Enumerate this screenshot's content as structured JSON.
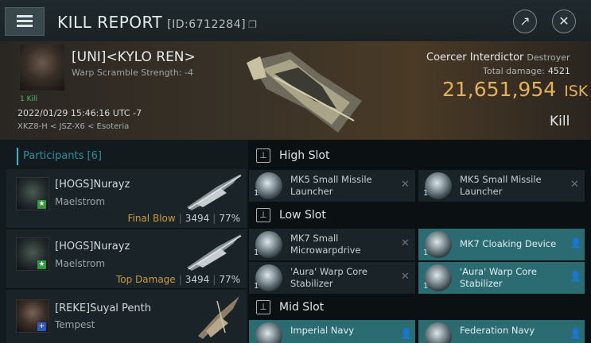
{
  "window": {
    "title": "KILL REPORT",
    "id_label": "[ID:6712284]"
  },
  "victim": {
    "name": "[UNI]<KYLO REN>",
    "warp_scramble": "Warp Scramble Strength: -4",
    "kill_count": "1 Kill",
    "datetime": "2022/01/29 15:46:16 UTC -7",
    "location": "XKZ8-H < JSZ-X6 < Esoteria",
    "ship_name": "Coercer Interdictor",
    "ship_class": "Destroyer",
    "total_damage_label": "Total damage:",
    "total_damage": "4521",
    "isk_value": "21,651,954",
    "isk_unit": "ISK",
    "result": "Kill"
  },
  "participants": {
    "header": "Participants [6]",
    "rows": [
      {
        "name": "[HOGS]Nurayz",
        "ship": "Maelstrom",
        "label": "Final Blow",
        "damage": "3494",
        "percent": "77%",
        "badge": "★",
        "badge_color": "#2f9a3c"
      },
      {
        "name": "[HOGS]Nurayz",
        "ship": "Maelstrom",
        "label": "Top Damage",
        "damage": "3494",
        "percent": "77%",
        "badge": "★",
        "badge_color": "#2f9a3c"
      },
      {
        "name": "[REKE]Suyal Penth",
        "ship": "Tempest",
        "label": "",
        "damage": "",
        "percent": "",
        "badge": "+",
        "badge_color": "#2b5ac0"
      }
    ]
  },
  "slots": {
    "high": {
      "title": "High Slot",
      "modules": [
        {
          "qty": "1",
          "name": "MK5 Small Missile Launcher",
          "active": false
        },
        {
          "qty": "1",
          "name": "MK5 Small Missile Launcher",
          "active": false
        }
      ]
    },
    "low": {
      "title": "Low Slot",
      "modules": [
        {
          "qty": "1",
          "name": "MK7 Small Microwarpdrive",
          "active": false
        },
        {
          "qty": "1",
          "name": "MK7 Cloaking Device",
          "active": true
        },
        {
          "qty": "1",
          "name": "'Aura' Warp Core Stabilizer",
          "active": false
        },
        {
          "qty": "1",
          "name": "'Aura' Warp Core Stabilizer",
          "active": true
        }
      ]
    },
    "mid": {
      "title": "Mid Slot",
      "modules": [
        {
          "qty": "",
          "name": "Imperial Navy",
          "active": true
        },
        {
          "qty": "",
          "name": "Federation Navy",
          "active": true
        }
      ]
    }
  }
}
